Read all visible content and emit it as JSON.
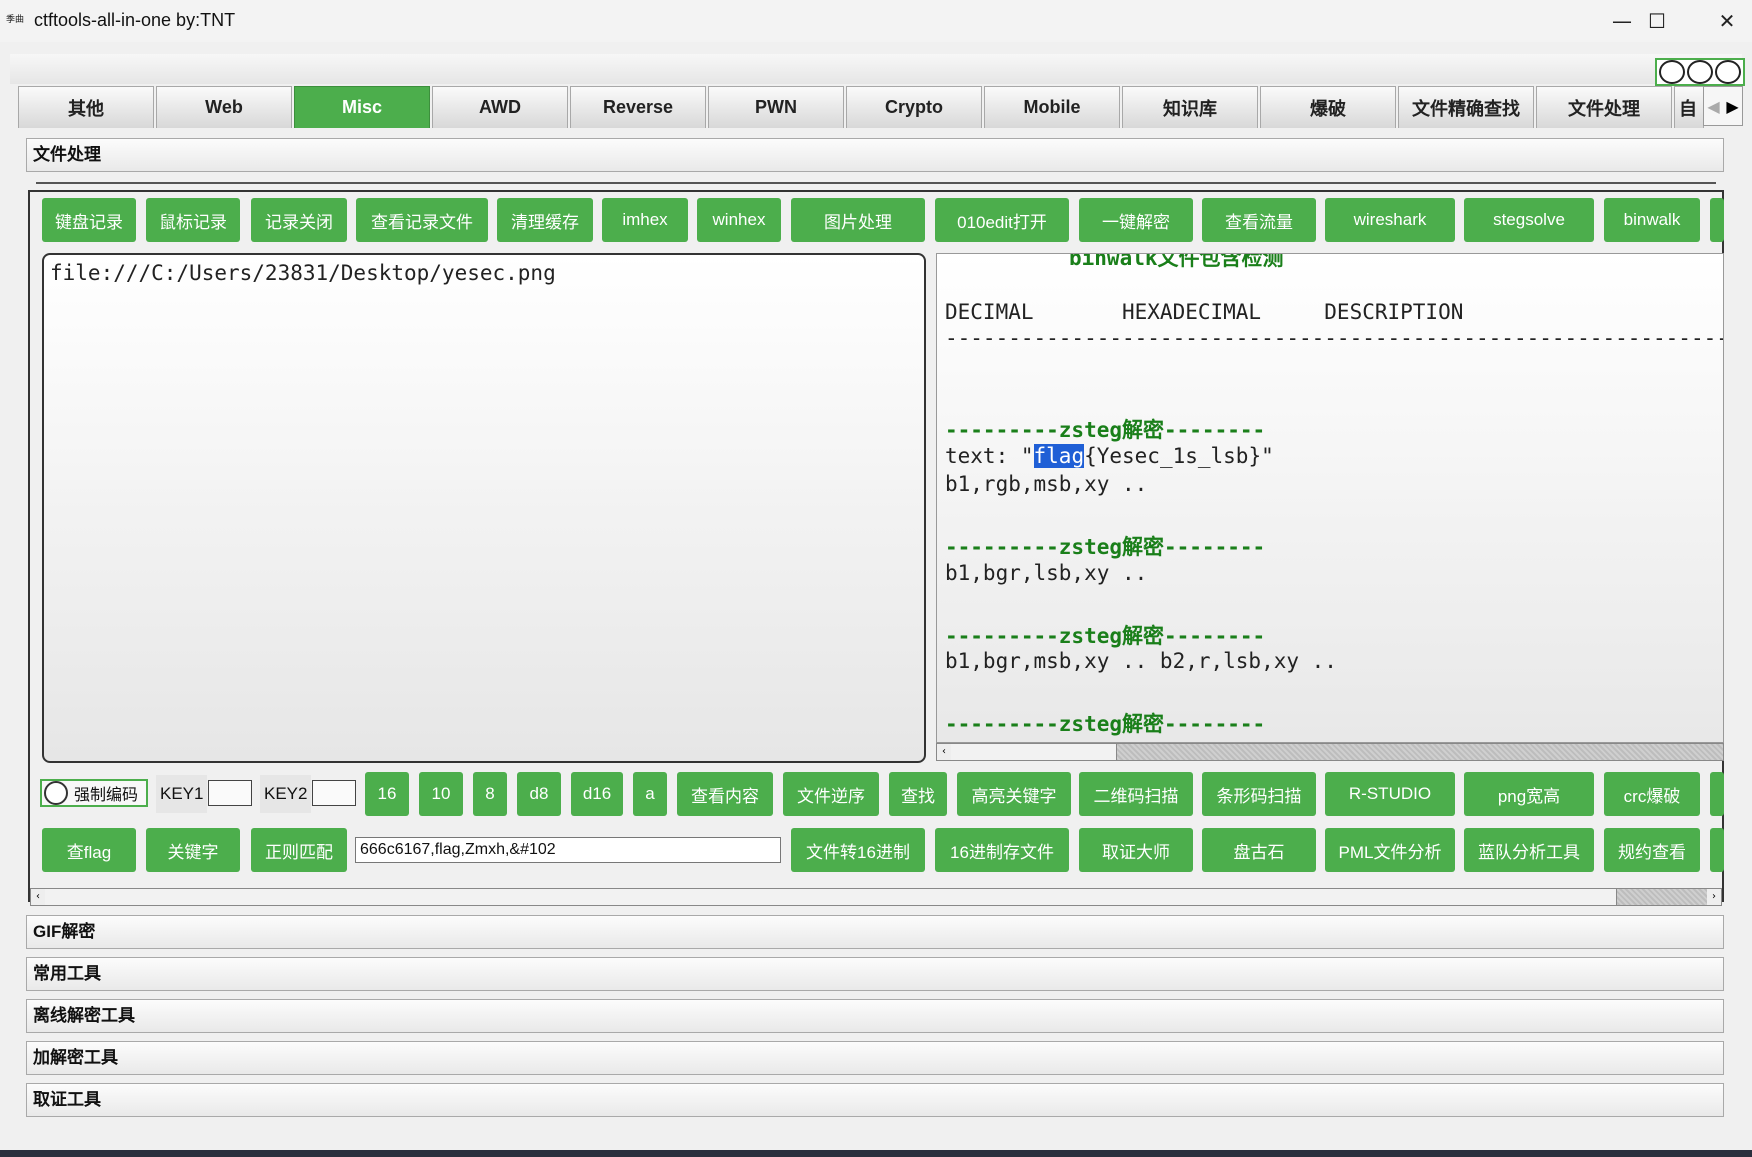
{
  "window": {
    "app_icon_text": "季曲",
    "title": "ctftools-all-in-one   by:TNT",
    "minimize": "—",
    "maximize": "☐",
    "close": "✕"
  },
  "tabs": [
    "其他",
    "Web",
    "Misc",
    "AWD",
    "Reverse",
    "PWN",
    "Crypto",
    "Mobile",
    "知识库",
    "爆破",
    "文件精确查找",
    "文件处理",
    "自"
  ],
  "active_tab": "Misc",
  "tab_scroll": {
    "left": "◀",
    "right": "▶"
  },
  "sections": {
    "file_processing": "文件处理",
    "gif": "GIF解密",
    "common_tools": "常用工具",
    "offline_decrypt": "离线解密工具",
    "crypto_tools": "加解密工具",
    "forensics_tools": "取证工具"
  },
  "toolbar_row1": [
    "键盘记录",
    "鼠标记录",
    "记录关闭",
    "查看记录文件",
    "清理缓存",
    "imhex",
    "winhex",
    "图片处理",
    "010edit打开",
    "一键解密",
    "查看流量",
    "wireshark",
    "stegsolve",
    "binwalk"
  ],
  "input_text": "file:///C:/Users/23831/Desktop/yesec.png",
  "output": {
    "partial_top": "binwalk文件包含检测",
    "header": "DECIMAL       HEXADECIMAL     DESCRIPTION",
    "rule": "--------------------------------------------------------------------------------",
    "zsteg_title": "---------zsteg解密--------",
    "text_prefix": "text: \"",
    "flag_hl": "flag",
    "flag_rest": "{Yesec_1s_lsb}\"",
    "line_b1_rgb": "b1,rgb,msb,xy ..",
    "line_b1_bgr_lsb": "b1,bgr,lsb,xy ..",
    "line_b1_bgr_msb": "b1,bgr,msb,xy .. b2,r,lsb,xy .."
  },
  "row2": {
    "force_encode": "强制编码",
    "key1": "KEY1",
    "key2": "KEY2",
    "buttons": [
      "16",
      "10",
      "8",
      "d8",
      "d16",
      "a",
      "查看内容",
      "文件逆序",
      "查找",
      "高亮关键字",
      "二维码扫描",
      "条形码扫描",
      "R-STUDIO",
      "png宽高",
      "crc爆破"
    ]
  },
  "row3": {
    "buttons_left": [
      "查flag",
      "关键字",
      "正则匹配"
    ],
    "search_value": "666c6167,flag,Zmxh,&#102",
    "buttons_right": [
      "文件转16进制",
      "16进制存文件",
      "取证大师",
      "盘古石",
      "PML文件分析",
      "蓝队分析工具",
      "规约查看"
    ]
  },
  "colors": {
    "accent_green": "#4cae4c"
  },
  "icons": [
    "app-icon",
    "minimize-icon",
    "maximize-icon",
    "close-icon",
    "tab-scroll-left-icon",
    "tab-scroll-right-icon"
  ]
}
